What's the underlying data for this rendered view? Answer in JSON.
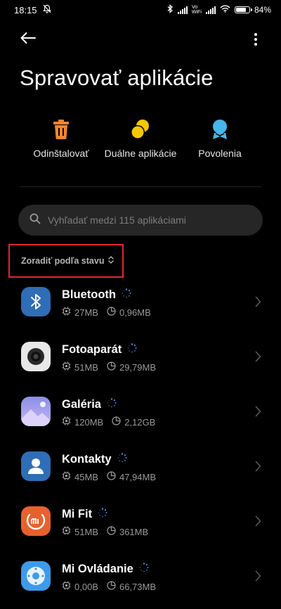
{
  "status_bar": {
    "time": "18:15",
    "volte_top": "Vo",
    "volte_bottom": "WiFi",
    "battery_text": "84%",
    "battery_level": 0.84
  },
  "header": {
    "title": "Spravovať aplikácie"
  },
  "actions": [
    {
      "label": "Odinštalovať",
      "icon": "trash-icon",
      "color": "#f5852f"
    },
    {
      "label": "Duálne aplikácie",
      "icon": "dual-apps-icon",
      "color": "#f5c800"
    },
    {
      "label": "Povolenia",
      "icon": "permissions-icon",
      "color": "#47b6ea"
    }
  ],
  "search": {
    "placeholder": "Vyhľadať medzi 115 aplikáciami"
  },
  "sort": {
    "label": "Zoradiť podľa stavu"
  },
  "apps": [
    {
      "name": "Bluetooth",
      "storage": "27MB",
      "cache": "0,96MB",
      "icon": "bluetooth-icon"
    },
    {
      "name": "Fotoaparát",
      "storage": "51MB",
      "cache": "29,79MB",
      "icon": "camera-icon"
    },
    {
      "name": "Galéria",
      "storage": "120MB",
      "cache": "2,12GB",
      "icon": "gallery-icon"
    },
    {
      "name": "Kontakty",
      "storage": "45MB",
      "cache": "47,94MB",
      "icon": "contacts-icon"
    },
    {
      "name": "Mi Fit",
      "storage": "51MB",
      "cache": "361MB",
      "icon": "mi-fit-icon"
    },
    {
      "name": "Mi Ovládanie",
      "storage": "0,00B",
      "cache": "66,73MB",
      "icon": "remote-icon"
    }
  ],
  "colors": {
    "background": "#000000",
    "search_bg": "#262626",
    "highlight_border": "#e3262f",
    "meta_text": "#9a9a9a",
    "spinner": "#4a90e2"
  }
}
